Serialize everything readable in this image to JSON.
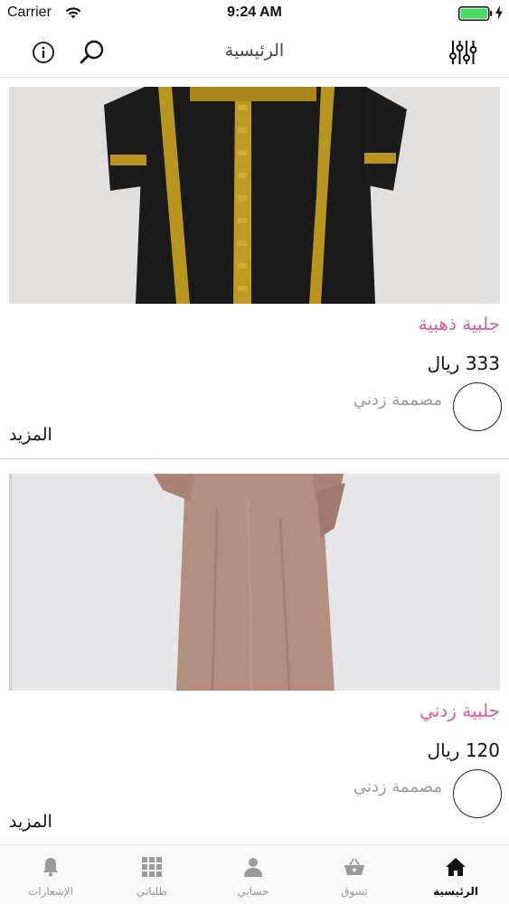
{
  "status_bar": {
    "carrier": "Carrier",
    "time": "9:24 AM",
    "battery_color": "#4cd964"
  },
  "nav": {
    "title": "الرئيسية",
    "icons": [
      "info-icon",
      "search-icon",
      "filter-sliders-icon"
    ]
  },
  "products": [
    {
      "name": "جلبية ذهبية",
      "price": "333 ريال",
      "designer": "مصممة زدني",
      "more": "المزيد",
      "image_colors": {
        "background": "#dcdcdc",
        "garment": "#1a1a1a",
        "trim": "#b8951f"
      }
    },
    {
      "name": "جلبية زدني",
      "price": "120 ريال",
      "designer": "مصممة زدني",
      "more": "المزيد",
      "image_colors": {
        "background": "#e6e6e8",
        "garment": "#b38f80"
      }
    }
  ],
  "tabs": [
    {
      "label": "الرئيسية",
      "icon": "home-icon",
      "active": true
    },
    {
      "label": "تسوق",
      "icon": "shopping-basket-icon",
      "active": false
    },
    {
      "label": "حسابي",
      "icon": "user-icon",
      "active": false
    },
    {
      "label": "طلباتي",
      "icon": "grid-icon",
      "active": false
    },
    {
      "label": "الإشعارات",
      "icon": "bell-icon",
      "active": false
    }
  ],
  "colors": {
    "accent_pink": "#e25a9c",
    "tab_inactive": "#9a9a9a",
    "tab_active": "#111111"
  }
}
